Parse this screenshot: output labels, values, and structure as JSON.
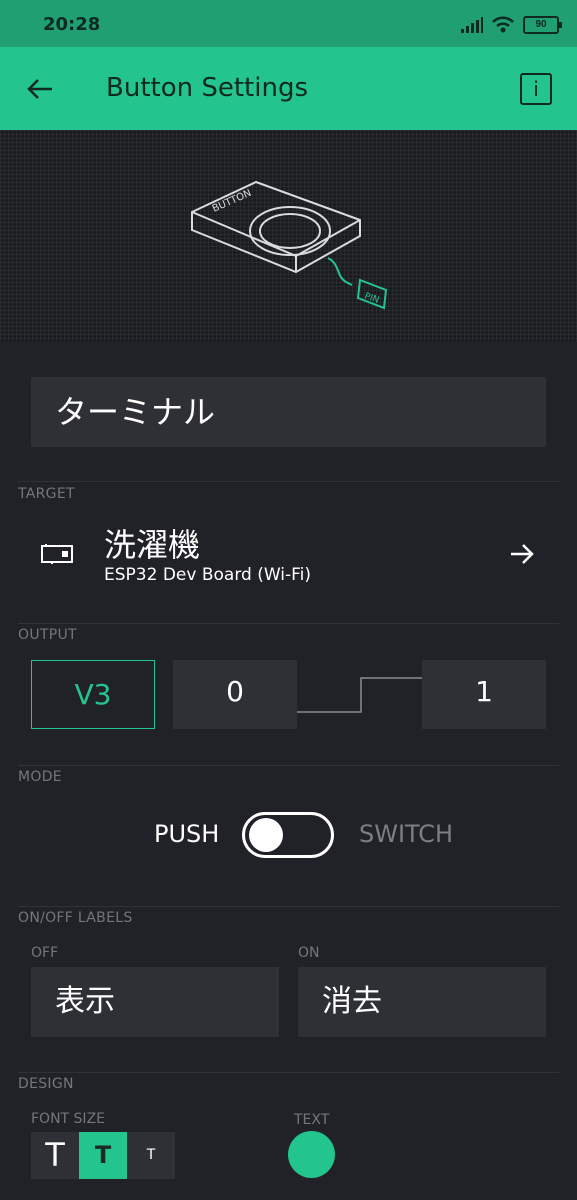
{
  "status_bar": {
    "time": "20:28",
    "battery": "90"
  },
  "app_bar": {
    "title": "Button Settings",
    "info_label": "i"
  },
  "hero": {
    "button_text": "BUTTON",
    "pin_text": "PIN"
  },
  "widget_name": "ターミナル",
  "target": {
    "section_label": "TARGET",
    "device_name": "洗濯機",
    "board": "ESP32 Dev Board (Wi-Fi)"
  },
  "output": {
    "section_label": "OUTPUT",
    "pin": "V3",
    "min": "0",
    "max": "1"
  },
  "mode": {
    "section_label": "MODE",
    "push_label": "PUSH",
    "switch_label": "SWITCH",
    "selected": "PUSH"
  },
  "labels": {
    "section_label": "ON/OFF LABELS",
    "off_label": "OFF",
    "on_label": "ON",
    "off_value": "表示",
    "on_value": "消去"
  },
  "design": {
    "section_label": "DESIGN",
    "font_size_label": "FONT SIZE",
    "text_label": "TEXT",
    "font_options": [
      "T",
      "T",
      "T"
    ],
    "selected_font_index": 1,
    "text_color": "#23c48e"
  },
  "colors": {
    "accent": "#23c48e",
    "background": "#212227",
    "field": "#2e3035"
  }
}
